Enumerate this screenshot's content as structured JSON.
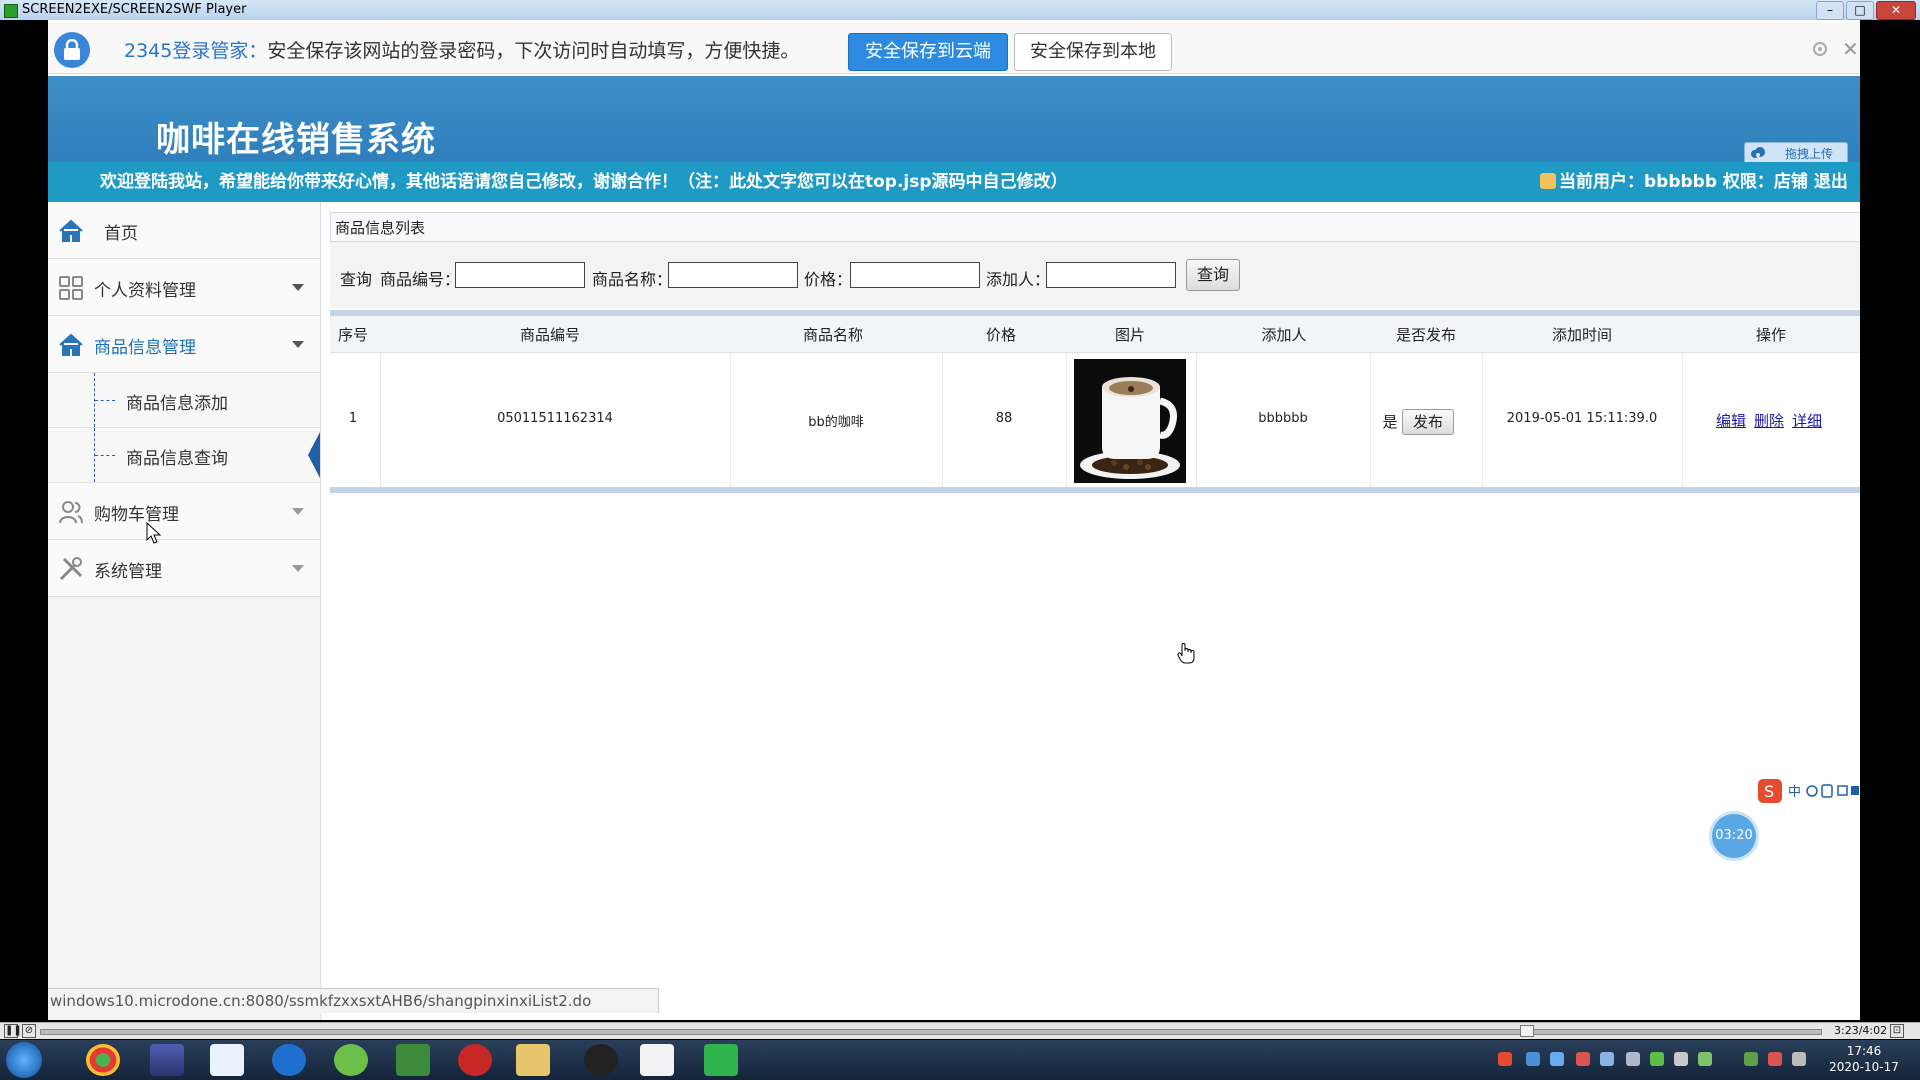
{
  "player": {
    "title": "SCREEN2EXE/SCREEN2SWF Player",
    "time_display": "3:23/4:02"
  },
  "notify": {
    "brand": "2345登录管家：",
    "message": "安全保存该网站的登录密码，下次访问时自动填写，方便快捷。",
    "save_cloud_label": "安全保存到云端",
    "save_local_label": "安全保存到本地"
  },
  "header": {
    "app_title": "咖啡在线销售系统",
    "upload_label": "拖拽上传",
    "welcome": "欢迎登陆我站，希望能给你带来好心情，其他话语请您自己修改，谢谢合作！（注：此处文字您可以在top.jsp源码中自己修改）",
    "user_info": "当前用户：bbbbbb 权限：店铺 退出"
  },
  "sidebar": {
    "items": [
      {
        "label": "首页"
      },
      {
        "label": "个人资料管理"
      },
      {
        "label": "商品信息管理"
      },
      {
        "label": "购物车管理"
      },
      {
        "label": "系统管理"
      }
    ],
    "sub_items": [
      {
        "label": "商品信息添加"
      },
      {
        "label": "商品信息查询"
      }
    ]
  },
  "content": {
    "panel_title": "商品信息列表",
    "search": {
      "query_label": "查询",
      "code_label": "商品编号：",
      "name_label": "商品名称：",
      "price_label": "价格：",
      "adder_label": "添加人：",
      "code_value": "",
      "name_value": "",
      "price_value": "",
      "adder_value": "",
      "button_label": "查询"
    },
    "table": {
      "headers": [
        "序号",
        "商品编号",
        "商品名称",
        "价格",
        "图片",
        "添加人",
        "是否发布",
        "添加时间",
        "操作"
      ],
      "rows": [
        {
          "index": "1",
          "code": "05011511162314",
          "name": "bb的咖啡",
          "price": "88",
          "adder": "bbbbbb",
          "published": "是",
          "publish_button": "发布",
          "added_time": "2019-05-01 15:11:39.0",
          "actions": [
            "编辑",
            "删除",
            "详细"
          ]
        }
      ]
    }
  },
  "status": {
    "url": "windows10.microdone.cn:8080/ssmkfzxxsxtAHB6/shangpinxinxiList2.do",
    "timer": "03:20"
  },
  "taskbar": {
    "time": "17:46",
    "date": "2020-10-17"
  }
}
